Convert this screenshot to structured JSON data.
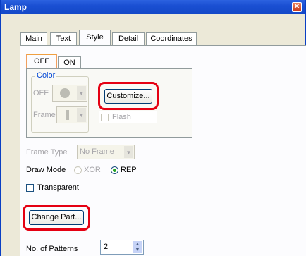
{
  "window": {
    "title": "Lamp",
    "close_glyph": "✕"
  },
  "tabs": [
    "Main",
    "Text",
    "Style",
    "Detail",
    "Coordinates"
  ],
  "active_tab": "Style",
  "subtabs": [
    "OFF",
    "ON"
  ],
  "color_group": {
    "title": "Color",
    "off_label": "OFF",
    "frame_label": "Frame",
    "customize_button": "Customize...",
    "flash_label": "Flash"
  },
  "frame_type": {
    "label": "Frame Type",
    "value": "No Frame"
  },
  "draw_mode": {
    "label": "Draw Mode",
    "options": [
      "XOR",
      "REP"
    ],
    "selected": "REP"
  },
  "transparent_label": "Transparent",
  "change_part_button": "Change Part...",
  "patterns": {
    "label": "No. of Patterns",
    "value": "2"
  },
  "colors": {
    "highlight_ring": "#e50012",
    "title_bar": "#1a4fd2"
  },
  "icons": {
    "close": "close-icon",
    "color_swatch": "palette-icon",
    "frame_swatch": "frame-icon",
    "spinner_up": "spin-up-icon",
    "spinner_down": "spin-down-icon"
  }
}
